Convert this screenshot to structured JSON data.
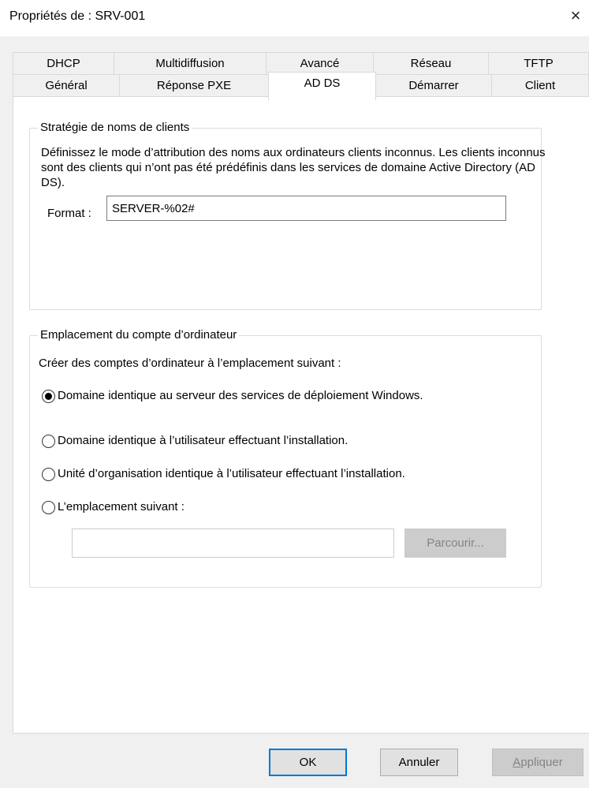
{
  "window": {
    "title": "Propriétés de : SRV-001",
    "close_glyph": "×"
  },
  "tabs": {
    "row1": [
      "DHCP",
      "Multidiffusion",
      "Avancé",
      "Réseau",
      "TFTP"
    ],
    "row2": [
      "Général",
      "Réponse PXE",
      "AD DS",
      "Démarrer",
      "Client"
    ],
    "active": "AD DS"
  },
  "naming_policy": {
    "legend": "Stratégie de noms de clients",
    "description": "Définissez le mode d’attribution des noms aux ordinateurs clients inconnus. Les clients inconnus sont des clients qui n’ont pas été prédéfinis dans les services de domaine Active Directory (AD DS).",
    "format_label": "Format :",
    "format_value": "SERVER-%02#"
  },
  "account_location": {
    "legend": "Emplacement du compte d’ordinateur",
    "intro": "Créer des comptes d’ordinateur à l’emplacement suivant :",
    "options": [
      {
        "label": "Domaine identique au serveur des services de déploiement Windows.",
        "checked": true
      },
      {
        "label": "Domaine identique à l’utilisateur effectuant l’installation.",
        "checked": false
      },
      {
        "label": "Unité d’organisation identique à l’utilisateur effectuant l’installation.",
        "checked": false
      },
      {
        "label": "L’emplacement suivant :",
        "checked": false
      }
    ],
    "location_value": "",
    "browse_label": "Parcourir..."
  },
  "buttons": {
    "ok": "OK",
    "cancel": "Annuler",
    "apply_mnemonic": "A",
    "apply_rest": "ppliquer"
  },
  "colors": {
    "accent": "#0078d7",
    "dialog_bg": "#f0f0f0",
    "disabled_bg": "#cccccc",
    "disabled_text": "#838383"
  }
}
